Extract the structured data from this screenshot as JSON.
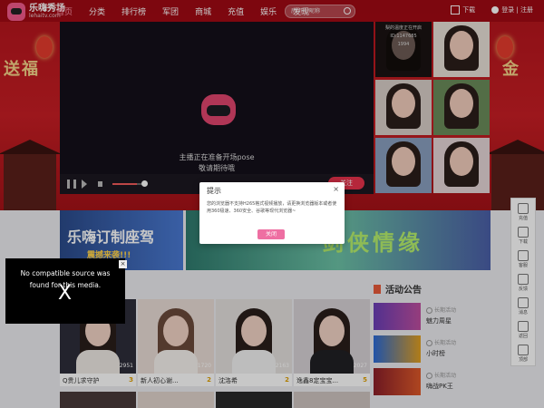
{
  "header": {
    "logo_title": "乐嗨秀场",
    "logo_domain": "lehaitv.com",
    "nav": [
      "首页",
      "分类",
      "排行榜",
      "军团",
      "商城",
      "充值",
      "娱乐",
      "发现"
    ],
    "search_placeholder": "房间号/昵称",
    "download_label": "下载",
    "login_label": "登录 | 注册"
  },
  "banner": {
    "left_text": "送福",
    "right_text": "金"
  },
  "player": {
    "message_line1": "主播正在准备开场pose",
    "message_line2": "敬请期待哦",
    "volume_level": 0.8,
    "follow_button": "关注"
  },
  "streamers": {
    "first_info": [
      "梨的温度正在开启",
      "ID:1147685",
      "1994"
    ]
  },
  "sidebar": {
    "items": [
      "充值",
      "下载",
      "客服",
      "反馈",
      "消息",
      "返回",
      "顶部"
    ]
  },
  "promos": {
    "promo1_title": "乐嗨订制座驾",
    "promo1_subtitle": "震撼来袭!!!",
    "promo2_title": "剑侠情缘"
  },
  "live_cards": [
    {
      "name": "Q贵儿求守护",
      "viewers": "2951",
      "level": "3"
    },
    {
      "name": "新人初心谢...",
      "viewers": "1720",
      "level": "2"
    },
    {
      "name": "沈洛希",
      "viewers": "2163",
      "level": "2"
    },
    {
      "name": "逸鑫8定宝宝...",
      "viewers": "2027",
      "level": "5"
    }
  ],
  "activity": {
    "title": "活动公告",
    "items": [
      {
        "tag": "长期活动",
        "title": "魅力周星"
      },
      {
        "tag": "长期活动",
        "title": "小时榜"
      },
      {
        "tag": "长期活动",
        "title": "嗨战PK王"
      }
    ]
  },
  "modal": {
    "title": "提示",
    "close": "×",
    "message": "您的浏览器不支持H265格式视频播放，请更换浏览器版本或者使用360极速、360安全、谷歌等现代浏览器~",
    "button": "关闭"
  },
  "no_source": {
    "message": "No compatible source was found for this media.",
    "big_x": "X",
    "close": "×"
  }
}
